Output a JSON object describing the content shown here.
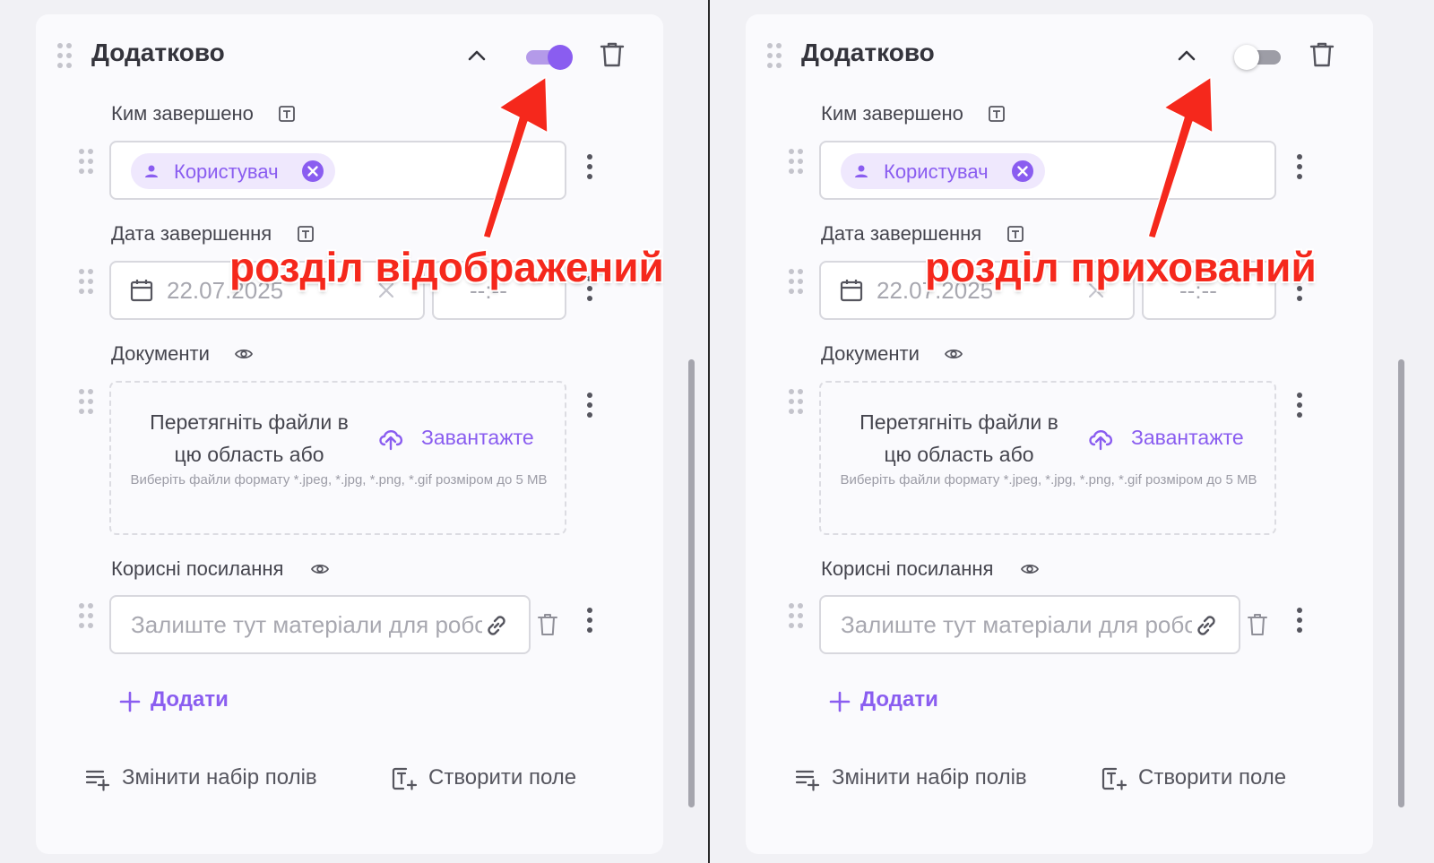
{
  "panels": [
    {
      "section_title": "Додатково",
      "toggle_state": "on",
      "annotation": "розділ відображений",
      "fields": {
        "completed_by": {
          "label": "Ким завершено",
          "chip": "Користувач"
        },
        "completion_date": {
          "label": "Дата завершення",
          "date_value": "22.07.2025",
          "time_value": "--:--"
        },
        "documents": {
          "label": "Документи",
          "drop_text": "Перетягніть файли в цю область або",
          "upload_label": "Завантажте",
          "hint": "Виберіть файли формату *.jpeg, *.jpg, *.png, *.gif розміром до 5 MB"
        },
        "links": {
          "label": "Корисні посилання",
          "placeholder": "Залиште тут матеріали для роботи"
        }
      },
      "add_label": "Додати",
      "footer": {
        "change_fields": "Змінити набір полів",
        "create_field": "Створити поле"
      }
    },
    {
      "section_title": "Додатково",
      "toggle_state": "off",
      "annotation": "розділ прихований",
      "fields": {
        "completed_by": {
          "label": "Ким завершено",
          "chip": "Користувач"
        },
        "completion_date": {
          "label": "Дата завершення",
          "date_value": "22.07.2025",
          "time_value": "--:--"
        },
        "documents": {
          "label": "Документи",
          "drop_text": "Перетягніть файли в цю область або",
          "upload_label": "Завантажте",
          "hint": "Виберіть файли формату *.jpeg, *.jpg, *.png, *.gif розміром до 5 MB"
        },
        "links": {
          "label": "Корисні посилання",
          "placeholder": "Залиште тут матеріали для роботи"
        }
      },
      "add_label": "Додати",
      "footer": {
        "change_fields": "Змінити набір полів",
        "create_field": "Створити поле"
      }
    }
  ],
  "colors": {
    "accent": "#8a5df0",
    "accent_light": "#efe8fd",
    "annotation_red": "#f5281c",
    "text": "#45454e",
    "placeholder": "#a8a8b0"
  },
  "icons": {
    "drag": "drag-handle-icon",
    "collapse": "chevron-up-icon",
    "delete": "trash-icon",
    "text_field": "text-field-icon",
    "visibility": "eye-icon",
    "user": "user-icon",
    "remove": "close-circle-icon",
    "more": "kebab-menu-icon",
    "calendar": "calendar-icon",
    "upload": "cloud-upload-icon",
    "link": "link-icon",
    "add": "plus-icon"
  }
}
